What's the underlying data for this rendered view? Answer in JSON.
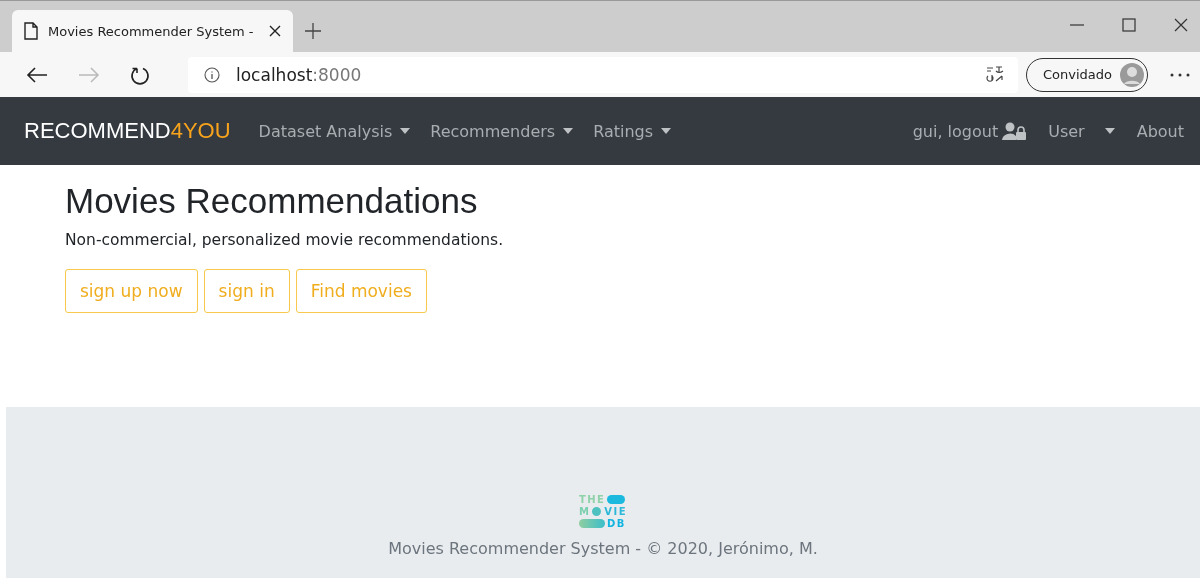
{
  "browser": {
    "tab_title": "Movies Recommender System - ",
    "address": {
      "host": "localhost",
      "port": ":8000"
    },
    "profile": "Convidado"
  },
  "navbar": {
    "brand": {
      "main": "RECOMMEND",
      "accent": "4YOU"
    },
    "left_items": [
      {
        "label": "Dataset Analysis",
        "dropdown": true
      },
      {
        "label": "Recommenders",
        "dropdown": true
      },
      {
        "label": "Ratings",
        "dropdown": true
      }
    ],
    "right_items": [
      {
        "label": "gui, logout",
        "kind": "user"
      },
      {
        "label": "User",
        "kind": "dropdown"
      },
      {
        "label": "About",
        "kind": "link"
      }
    ]
  },
  "hero": {
    "title": "Movies Recommendations",
    "lead": "Non-commercial, personalized movie recommendations.",
    "buttons": [
      "sign up now",
      "sign in",
      "Find movies"
    ]
  },
  "footer": {
    "logo": {
      "line_1": "THE",
      "line_2_start": "M",
      "line_2_end": "VIE",
      "line_3": "DB"
    },
    "text": "Movies Recommender System - © 2020, Jerónimo, M."
  }
}
